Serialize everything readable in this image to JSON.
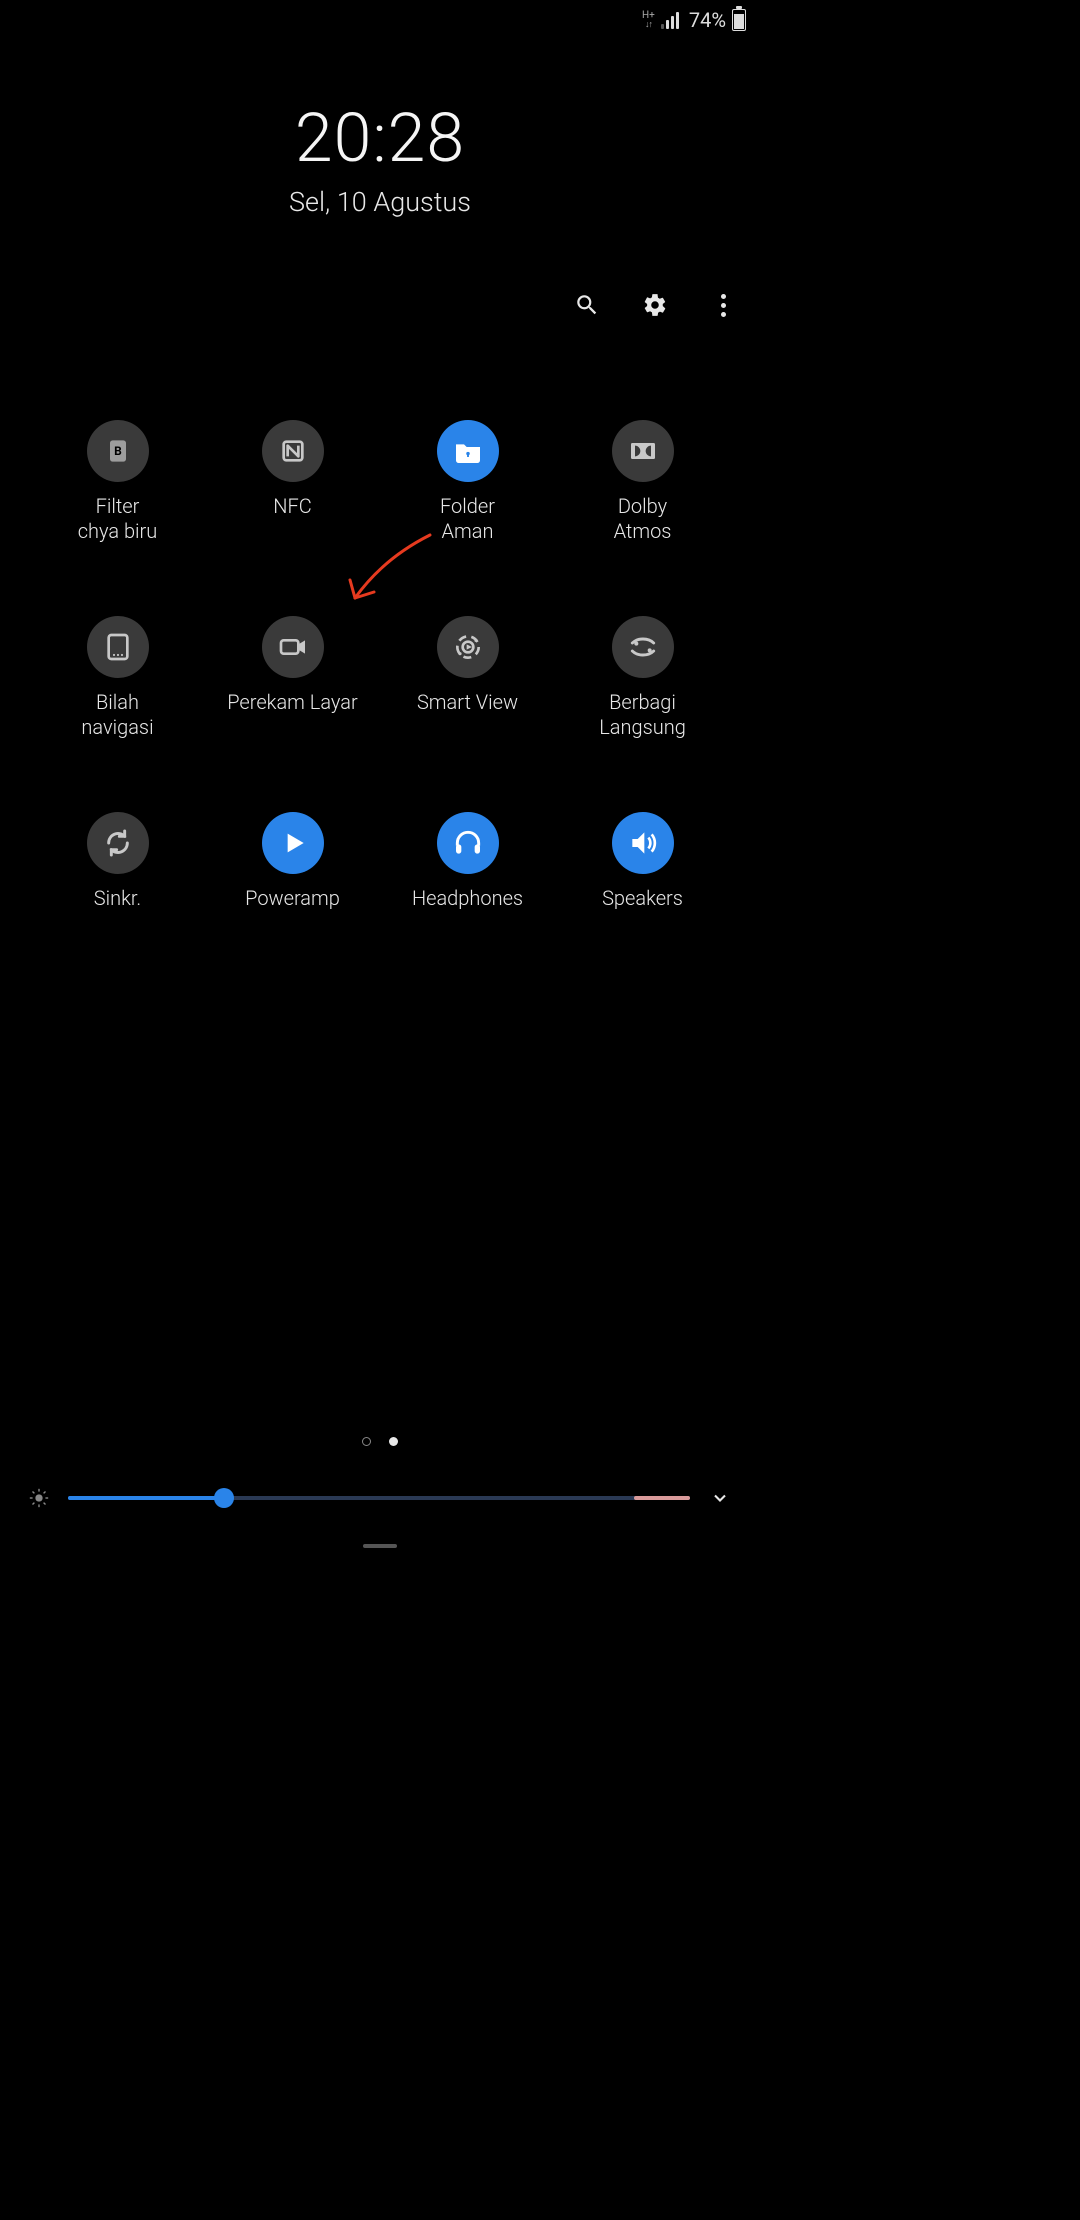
{
  "status": {
    "network_type": "H+",
    "signal_bars_active": 3,
    "signal_bars_total": 4,
    "battery_percent": "74%"
  },
  "clock": {
    "time": "20:28",
    "date": "Sel, 10 Agustus"
  },
  "toolbar": {
    "search_icon": "search-icon",
    "settings_icon": "gear-icon",
    "more_icon": "more-vert-icon"
  },
  "tiles": [
    {
      "id": "blue-light-filter",
      "label": "Filter\nchya biru",
      "active": false,
      "icon": "bluelight"
    },
    {
      "id": "nfc",
      "label": "NFC",
      "active": false,
      "icon": "nfc"
    },
    {
      "id": "secure-folder",
      "label": "Folder\nAman",
      "active": true,
      "icon": "securefolder"
    },
    {
      "id": "dolby-atmos",
      "label": "Dolby\nAtmos",
      "active": false,
      "icon": "dolby"
    },
    {
      "id": "nav-bar",
      "label": "Bilah\nnavigasi",
      "active": false,
      "icon": "navbar"
    },
    {
      "id": "screen-recorder",
      "label": "Perekam Layar",
      "active": false,
      "icon": "recorder"
    },
    {
      "id": "smart-view",
      "label": "Smart View",
      "active": false,
      "icon": "smartview"
    },
    {
      "id": "live-share",
      "label": "Berbagi\nLangsung",
      "active": false,
      "icon": "liveshare"
    },
    {
      "id": "sync",
      "label": "Sinkr.",
      "active": false,
      "icon": "sync"
    },
    {
      "id": "poweramp",
      "label": "Poweramp",
      "active": true,
      "icon": "play"
    },
    {
      "id": "headphones",
      "label": "Headphones",
      "active": true,
      "icon": "headphones"
    },
    {
      "id": "speakers",
      "label": "Speakers",
      "active": true,
      "icon": "speakers"
    }
  ],
  "page_indicator": {
    "current": 2,
    "total": 2
  },
  "brightness": {
    "percent": 25
  },
  "annotation": {
    "arrow_target": "smart-view"
  }
}
